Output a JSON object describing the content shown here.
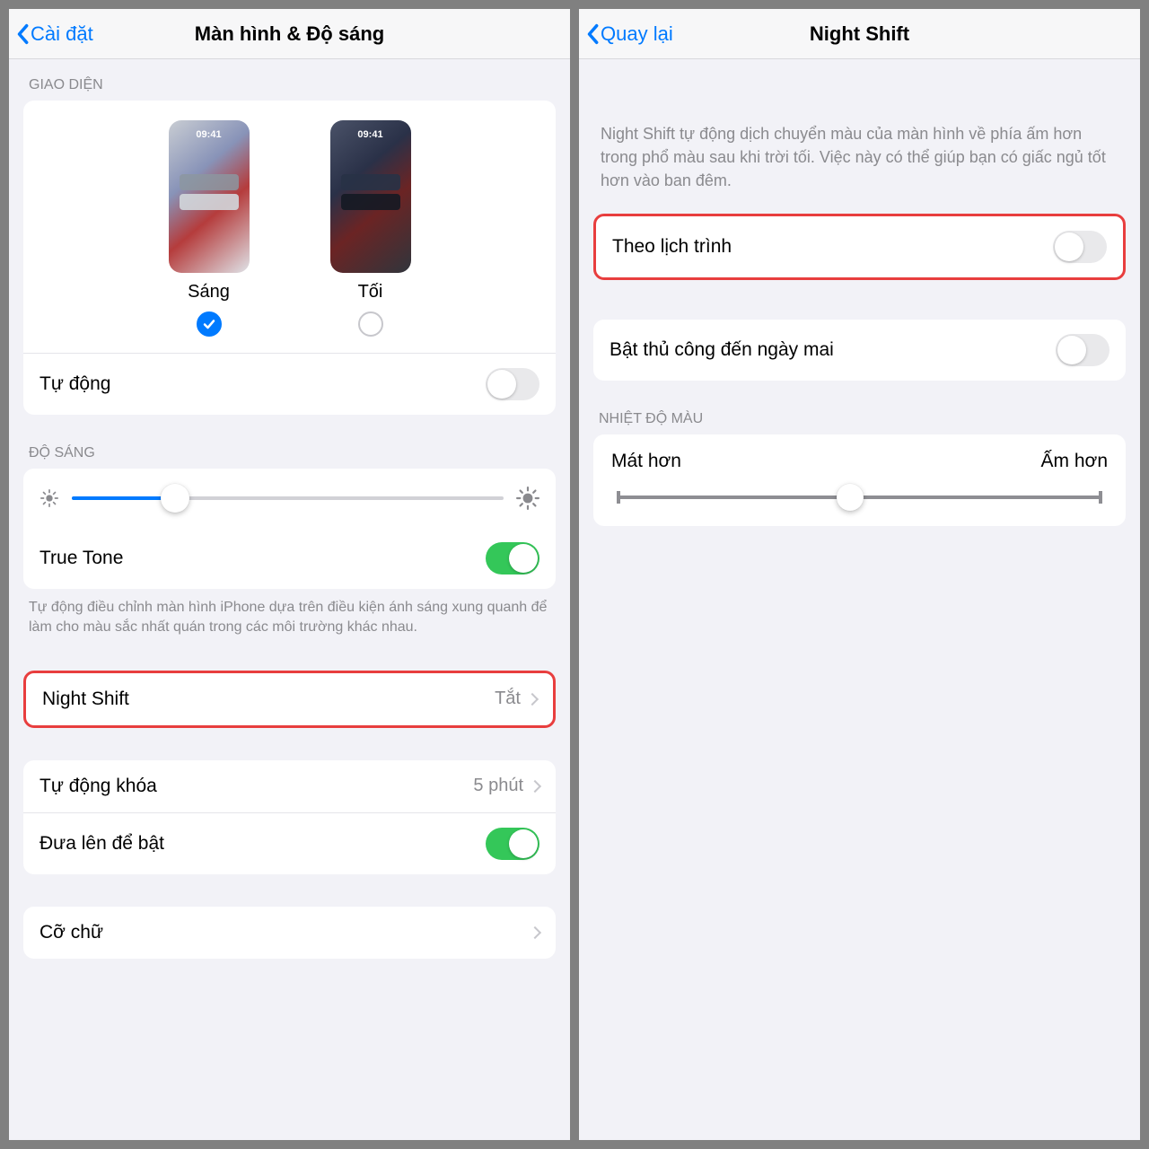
{
  "left": {
    "back": "Cài đặt",
    "title": "Màn hình & Độ sáng",
    "appearance": {
      "header": "GIAO DIỆN",
      "clock": "09:41",
      "light_label": "Sáng",
      "dark_label": "Tối",
      "selected": "light",
      "auto_label": "Tự động",
      "auto_on": false
    },
    "brightness": {
      "header": "ĐỘ SÁNG",
      "value_percent": 24,
      "true_tone_label": "True Tone",
      "true_tone_on": true,
      "footer": "Tự động điều chỉnh màn hình iPhone dựa trên điều kiện ánh sáng xung quanh để làm cho màu sắc nhất quán trong các môi trường khác nhau."
    },
    "night_shift": {
      "label": "Night Shift",
      "value": "Tắt"
    },
    "auto_lock": {
      "label": "Tự động khóa",
      "value": "5 phút"
    },
    "raise_to_wake": {
      "label": "Đưa lên để bật",
      "on": true
    },
    "text_size": {
      "label": "Cỡ chữ"
    }
  },
  "right": {
    "back": "Quay lại",
    "title": "Night Shift",
    "explain": "Night Shift tự động dịch chuyển màu của màn hình về phía ấm hơn trong phổ màu sau khi trời tối. Việc này có thể giúp bạn có giấc ngủ tốt hơn vào ban đêm.",
    "scheduled": {
      "label": "Theo lịch trình",
      "on": false
    },
    "manual": {
      "label": "Bật thủ công đến ngày mai",
      "on": false
    },
    "color_temp": {
      "header": "NHIỆT ĐỘ MÀU",
      "less": "Mát hơn",
      "more": "Ấm hơn",
      "value_percent": 48
    }
  }
}
